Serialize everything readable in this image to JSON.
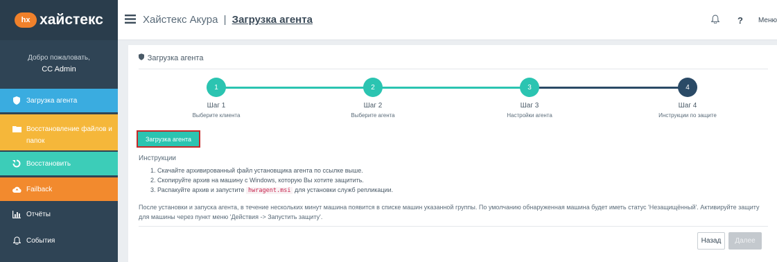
{
  "brand": {
    "badge": "hx",
    "name": "хайстекс"
  },
  "welcome": {
    "greeting": "Добро пожаловать,",
    "user": "CC Admin"
  },
  "sidebar": {
    "items": [
      {
        "label": "Загрузка агента",
        "icon": "shield-icon"
      },
      {
        "label": "Восстановление файлов и папок",
        "icon": "folder-icon"
      },
      {
        "label": "Восстановить",
        "icon": "restore-icon"
      },
      {
        "label": "Failback",
        "icon": "cloud-upload-icon"
      },
      {
        "label": "Отчёты",
        "icon": "bar-chart-icon"
      },
      {
        "label": "События",
        "icon": "bell-icon"
      }
    ]
  },
  "topbar": {
    "product": "Хайстекс Акура",
    "separator": "|",
    "current_page": "Загрузка агента",
    "help": "?",
    "menu": "Меню"
  },
  "panel": {
    "title": "Загрузка агента",
    "steps": [
      {
        "number": "1",
        "label": "Шаг 1",
        "desc": "Выберите клиента"
      },
      {
        "number": "2",
        "label": "Шаг 2",
        "desc": "Выберите агента"
      },
      {
        "number": "3",
        "label": "Шаг 3",
        "desc": "Настройки агента"
      },
      {
        "number": "4",
        "label": "Шаг 4",
        "desc": "Инструкции по защите"
      }
    ],
    "upload_button": "Загрузка агента",
    "instructions_title": "Инструкции",
    "instructions": {
      "item1": "1. Скачайте архивированный файл установщика агента по ссылке выше.",
      "item2": "2. Скопируйте архив на машину с Windows, которую Вы хотите защитить.",
      "item3_prefix": "3. Распакуйте архив и запустите",
      "item3_code": "hwragent.msi",
      "item3_suffix": "для установки служб репликации."
    },
    "note": "После установки и запуска агента, в течение нескольких минут машина появится в списке машин указанной группы. По умолчанию обнаруженная машина будет иметь статус 'Незащищённый'. Активируйте защиту для машины через пункт меню 'Действия -> Запустить защиту'.",
    "back_button": "Назад",
    "next_button": "Далее"
  },
  "colors": {
    "sidebar_bg": "#2f4455",
    "upload_agent": "#3aace0",
    "restore_files": "#f5b73a",
    "restore": "#3ccdb8",
    "failback": "#f28a2e",
    "step_done": "#2bc4b1",
    "step_current": "#2a4a66"
  }
}
